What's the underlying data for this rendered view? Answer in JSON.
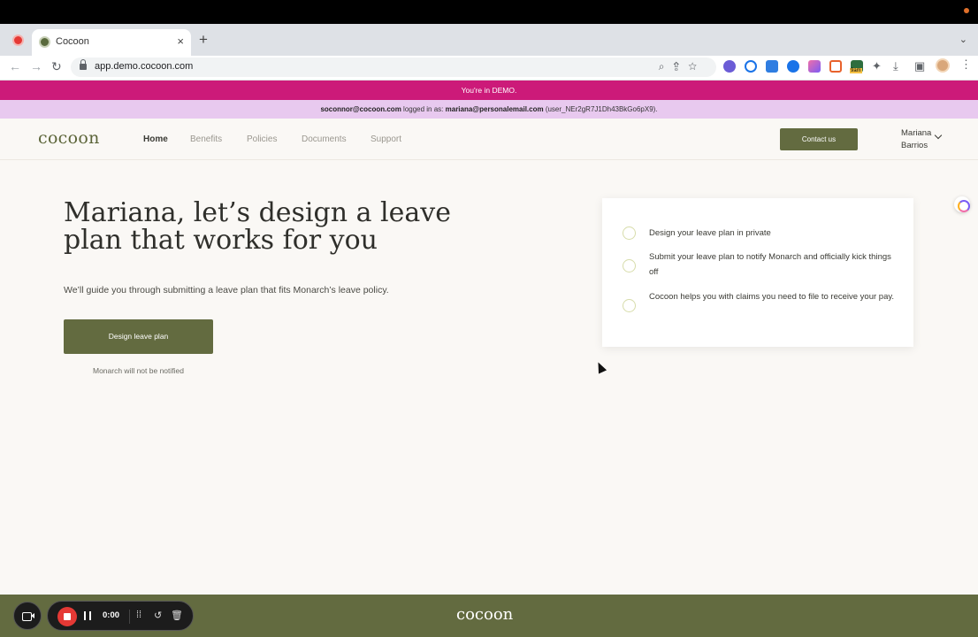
{
  "browser": {
    "tab_title": "Cocoon",
    "tab_close": "×",
    "new_tab": "+",
    "tab_menu": "⌄",
    "back": "←",
    "forward": "→",
    "reload": "↻",
    "url": "app.demo.cocoon.com",
    "omnibox_icons": "⌕⇪☆",
    "extension_badge": "9am",
    "menu": "⋮"
  },
  "banners": {
    "demo": "You're in DEMO.",
    "login_admin": "soconnor@cocoon.com",
    "login_mid": " logged in as: ",
    "login_user": "mariana@personalemail.com",
    "login_id": " (user_NEr2gR7J1Dh43BkGo6pX9)."
  },
  "header": {
    "logo": "cocoon",
    "nav": [
      "Home",
      "Benefits",
      "Policies",
      "Documents",
      "Support"
    ],
    "contact_label": "Contact us",
    "user_first": "Mariana",
    "user_last": "Barrios"
  },
  "hero": {
    "title": "Mariana, let’s design a leave plan that works for you",
    "subtitle": "We’ll guide you through submitting a leave plan that fits Monarch’s leave policy.",
    "cta_label": "Design leave plan",
    "hint": "Monarch will not be notified"
  },
  "steps": [
    "Design your leave plan in private",
    "Submit your leave plan to notify Monarch and officially kick things off",
    "Cocoon helps you with claims you need to file to receive your pay."
  ],
  "footer": {
    "logo": "cocoon",
    "timer": "0:00"
  },
  "colors": {
    "brand_olive": "#636b40",
    "demo_pink": "#cc1a79",
    "login_lilac": "#e8c9ef",
    "record_red": "#e53935"
  }
}
